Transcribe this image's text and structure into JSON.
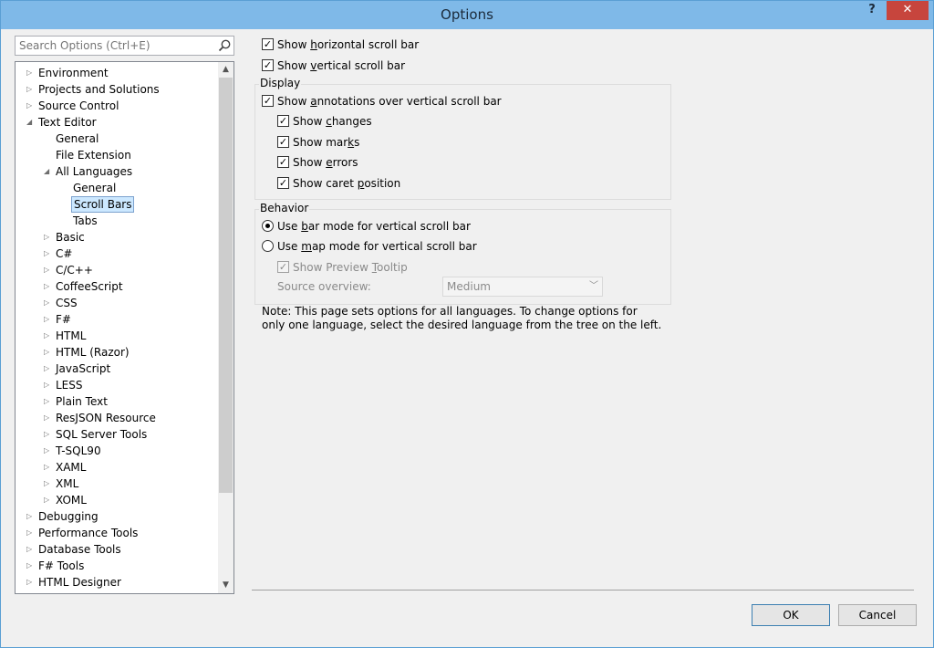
{
  "window": {
    "title": "Options",
    "help_label": "?",
    "close_label": "✕"
  },
  "search": {
    "placeholder": "Search Options (Ctrl+E)",
    "icon": "search-icon"
  },
  "tree": {
    "items": [
      {
        "label": "Environment",
        "expander": "collapsed"
      },
      {
        "label": "Projects and Solutions",
        "expander": "collapsed"
      },
      {
        "label": "Source Control",
        "expander": "collapsed"
      },
      {
        "label": "Text Editor",
        "expander": "expanded"
      },
      {
        "label": "General",
        "expander": "none"
      },
      {
        "label": "File Extension",
        "expander": "none"
      },
      {
        "label": "All Languages",
        "expander": "expanded"
      },
      {
        "label": "General",
        "expander": "none"
      },
      {
        "label": "Scroll Bars",
        "expander": "none",
        "selected": true
      },
      {
        "label": "Tabs",
        "expander": "none"
      },
      {
        "label": "Basic",
        "expander": "collapsed"
      },
      {
        "label": "C#",
        "expander": "collapsed"
      },
      {
        "label": "C/C++",
        "expander": "collapsed"
      },
      {
        "label": "CoffeeScript",
        "expander": "collapsed"
      },
      {
        "label": "CSS",
        "expander": "collapsed"
      },
      {
        "label": "F#",
        "expander": "collapsed"
      },
      {
        "label": "HTML",
        "expander": "collapsed"
      },
      {
        "label": "HTML (Razor)",
        "expander": "collapsed"
      },
      {
        "label": "JavaScript",
        "expander": "collapsed"
      },
      {
        "label": "LESS",
        "expander": "collapsed"
      },
      {
        "label": "Plain Text",
        "expander": "collapsed"
      },
      {
        "label": "ResJSON Resource",
        "expander": "collapsed"
      },
      {
        "label": "SQL Server Tools",
        "expander": "collapsed"
      },
      {
        "label": "T-SQL90",
        "expander": "collapsed"
      },
      {
        "label": "XAML",
        "expander": "collapsed"
      },
      {
        "label": "XML",
        "expander": "collapsed"
      },
      {
        "label": "XOML",
        "expander": "collapsed"
      },
      {
        "label": "Debugging",
        "expander": "collapsed"
      },
      {
        "label": "Performance Tools",
        "expander": "collapsed"
      },
      {
        "label": "Database Tools",
        "expander": "collapsed"
      },
      {
        "label": "F# Tools",
        "expander": "collapsed"
      },
      {
        "label": "HTML Designer",
        "expander": "collapsed"
      }
    ]
  },
  "options": {
    "show_horizontal": {
      "pre": "Show ",
      "key": "h",
      "post": "orizontal scroll bar",
      "checked": true
    },
    "show_vertical": {
      "pre": "Show ",
      "key": "v",
      "post": "ertical scroll bar",
      "checked": true
    },
    "display": {
      "title": "Display",
      "annotations": {
        "pre": "Show ",
        "key": "a",
        "post": "nnotations over vertical scroll bar",
        "checked": true
      },
      "changes": {
        "pre": "Show ",
        "key": "c",
        "post": "hanges",
        "checked": true
      },
      "marks": {
        "pre": "Show mar",
        "key": "k",
        "post": "s",
        "checked": true
      },
      "errors": {
        "pre": "Show ",
        "key": "e",
        "post": "rrors",
        "checked": true
      },
      "caret": {
        "pre": "Show caret ",
        "key": "p",
        "post": "osition",
        "checked": true
      }
    },
    "behavior": {
      "title": "Behavior",
      "bar_mode": {
        "pre": "Use ",
        "key": "b",
        "post": "ar mode for vertical scroll bar",
        "selected": true
      },
      "map_mode": {
        "pre": "Use ",
        "key": "m",
        "post": "ap mode for vertical scroll bar",
        "selected": false
      },
      "preview_tooltip": {
        "pre": "Show Preview ",
        "key": "T",
        "post": "ooltip",
        "checked": true,
        "enabled": false
      },
      "source_overview_label": "Source overview:",
      "source_overview_value": "Medium"
    },
    "note": "Note: This page sets options for all languages. To change options for only one language, select the desired language from the tree on the left."
  },
  "buttons": {
    "ok": "OK",
    "cancel": "Cancel"
  }
}
